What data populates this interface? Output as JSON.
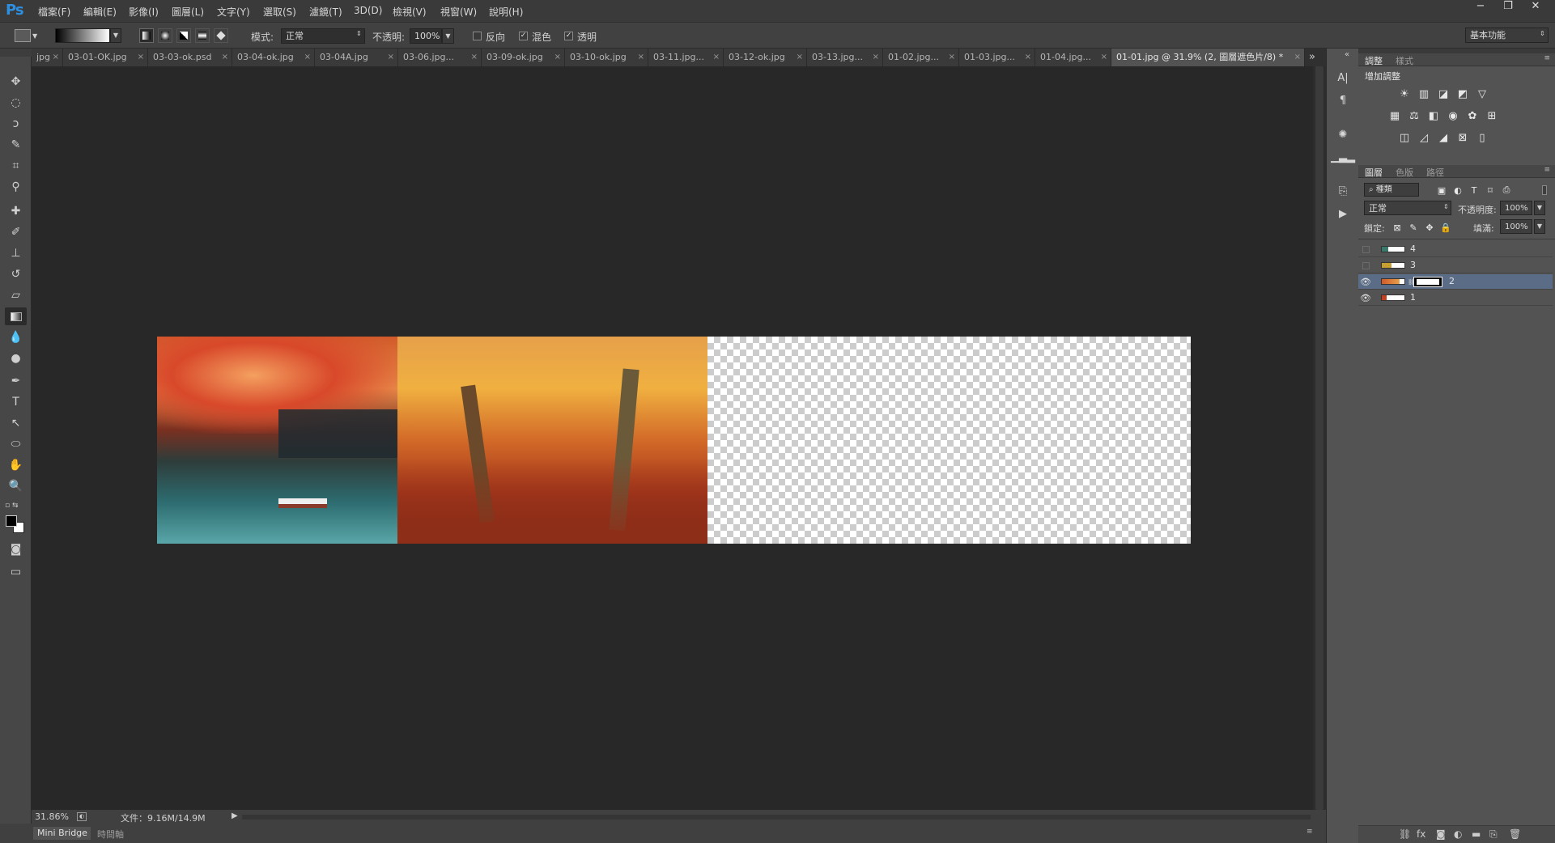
{
  "app": {
    "logo": "Ps"
  },
  "menu": [
    "檔案(F)",
    "編輯(E)",
    "影像(I)",
    "圖層(L)",
    "文字(Y)",
    "選取(S)",
    "濾鏡(T)",
    "3D(D)",
    "檢視(V)",
    "視窗(W)",
    "說明(H)"
  ],
  "window_controls": {
    "minimize": "−",
    "restore": "❐",
    "close": "✕"
  },
  "options": {
    "mode_label": "模式:",
    "mode_value": "正常",
    "opacity_label": "不透明:",
    "opacity_value": "100%",
    "reverse_label": "反向",
    "dither_label": "混色",
    "transparency_label": "透明",
    "workspace": "基本功能"
  },
  "tabs": [
    {
      "label": "jpg"
    },
    {
      "label": "03-01-OK.jpg"
    },
    {
      "label": "03-03-ok.psd"
    },
    {
      "label": "03-04-ok.jpg"
    },
    {
      "label": "03-04A.jpg"
    },
    {
      "label": "03-06.jpg..."
    },
    {
      "label": "03-09-ok.jpg"
    },
    {
      "label": "03-10-ok.jpg"
    },
    {
      "label": "03-11.jpg..."
    },
    {
      "label": "03-12-ok.jpg"
    },
    {
      "label": "03-13.jpg..."
    },
    {
      "label": "01-02.jpg..."
    },
    {
      "label": "01-03.jpg..."
    },
    {
      "label": "01-04.jpg..."
    },
    {
      "label": "01-01.jpg @ 31.9% (2, 圖層遮色片/8) *"
    }
  ],
  "tab_close": "×",
  "tabs_overflow": "»",
  "status": {
    "zoom": "31.86%",
    "doc": "文件：9.16M/14.9M"
  },
  "bottom_tabs": [
    "Mini Bridge",
    "時間軸"
  ],
  "adjustments": {
    "tabs": [
      "調整",
      "樣式"
    ],
    "title": "增加調整"
  },
  "layers_panel": {
    "tabs": [
      "圖層",
      "色版",
      "路徑"
    ],
    "filter_label": "種類",
    "blend_mode": "正常",
    "opacity_label": "不透明度:",
    "opacity_value": "100%",
    "lock_label": "鎖定:",
    "fill_label": "填滿:",
    "fill_value": "100%",
    "layers": [
      {
        "name": "4",
        "visible": false,
        "selected": false,
        "has_mask": false
      },
      {
        "name": "3",
        "visible": false,
        "selected": false,
        "has_mask": false
      },
      {
        "name": "2",
        "visible": true,
        "selected": true,
        "has_mask": true
      },
      {
        "name": "1",
        "visible": true,
        "selected": false,
        "has_mask": false
      }
    ],
    "footer_icons": [
      "link-icon",
      "fx-icon",
      "mask-icon",
      "adjustment-icon",
      "folder-icon",
      "new-layer-icon",
      "trash-icon"
    ]
  },
  "colors": {
    "accent": "#2e8fe0",
    "selected_layer": "#5a6c86"
  }
}
